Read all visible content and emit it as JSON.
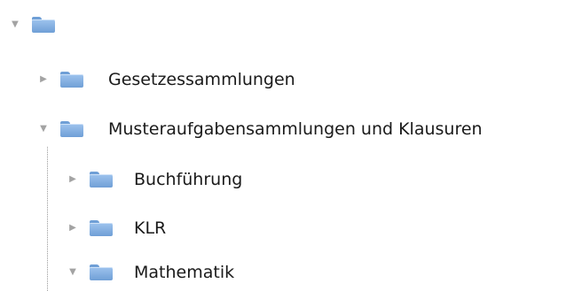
{
  "tree": {
    "root": {
      "label": "",
      "expanded": true
    },
    "nodes": [
      {
        "label": "Gesetzessammlungen",
        "expanded": false
      },
      {
        "label": "Musteraufgabensammlungen und Klausuren",
        "expanded": true
      },
      {
        "label": "Buchführung",
        "expanded": false
      },
      {
        "label": "KLR",
        "expanded": false
      },
      {
        "label": "Mathematik",
        "expanded": true
      }
    ],
    "icons": {
      "expanded": "triangle-down-icon",
      "collapsed": "triangle-right-icon",
      "folder": "folder-icon"
    },
    "colors": {
      "folder": "#6f9fd6",
      "toggle": "#a3a3a3"
    }
  }
}
